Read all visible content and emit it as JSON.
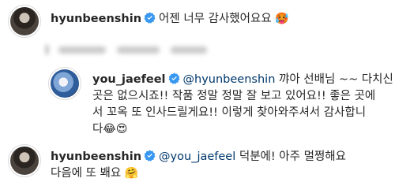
{
  "comments": [
    {
      "username": "hyunbeenshin",
      "text": "어젠 너무 감사했어요요",
      "emoji": "🥵"
    },
    {
      "username": "you_jaefeel",
      "mention": "@hyunbeenshin",
      "text_line1": " 꺄아 선배님 ~~ 다치신",
      "text_line2": "곳은 없으시죠!! 작품 정말 정말 잘 보고 있어요!! 좋은 곳에",
      "text_line3": "서 꼬옥 또 인사드릴게요!! 이렇게 찾아와주셔서 감사합니",
      "text_line4": "다",
      "emoji": "😂😍"
    },
    {
      "username": "hyunbeenshin",
      "mention": "@you_jaefeel",
      "text_line1": " 덕분에! 아주 멀쩡해요",
      "text_line2": "다음에 또 봬요",
      "emoji": "🤗"
    }
  ],
  "colors": {
    "verified": "#3897f0",
    "mention": "#00376b",
    "text": "#262626"
  },
  "icons": [
    "verified-badge-icon"
  ]
}
